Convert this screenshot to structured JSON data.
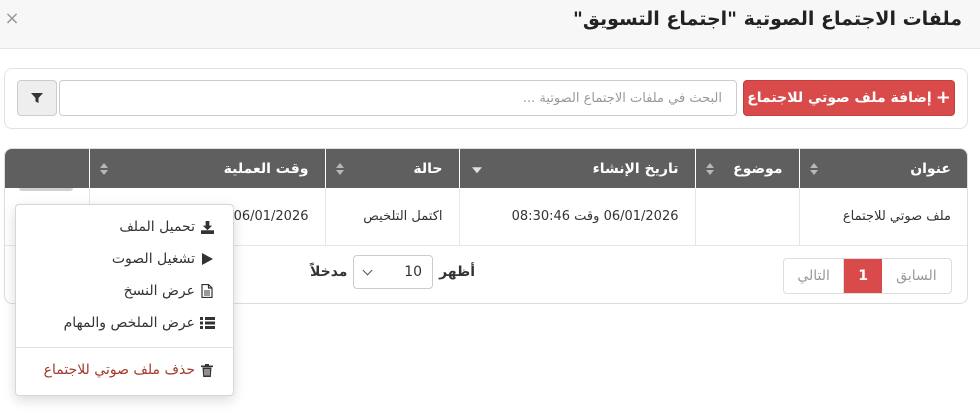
{
  "header": {
    "title": "ملفات الاجتماع الصوتية \"اجتماع التسويق\"",
    "close_glyph": "×"
  },
  "toolbar": {
    "add_label": "إضافة ملف صوتي للاجتماع",
    "search_placeholder": "البحث في ملفات الاجتماع الصوتية ...",
    "search_value": ""
  },
  "table": {
    "columns": [
      "عنوان",
      "موضوع",
      "تاريخ الإنشاء",
      "حالة",
      "وقت العملية"
    ],
    "rows": [
      {
        "title": "ملف صوتي للاجتماع",
        "subject": "",
        "created": "06/01/2026 وقت 08:30:46",
        "status": "اكتمل التلخيص",
        "operation_time": "06/01/2026"
      }
    ]
  },
  "pagination": {
    "prev": "السابق",
    "current": "1",
    "next": "التالي"
  },
  "length": {
    "show_label": "أظهر",
    "value": "10",
    "entries_label": "مدخلاً"
  },
  "row_menu": {
    "download": "تحميل الملف",
    "play": "تشغيل الصوت",
    "transcript": "عرض النسخ",
    "summary": "عرض الملخص والمهام",
    "delete": "حذف ملف صوتي للاجتماع"
  },
  "colors": {
    "accent": "#d94b4b",
    "header_bg": "#5f5f5f",
    "danger_text": "#a23a2a"
  }
}
